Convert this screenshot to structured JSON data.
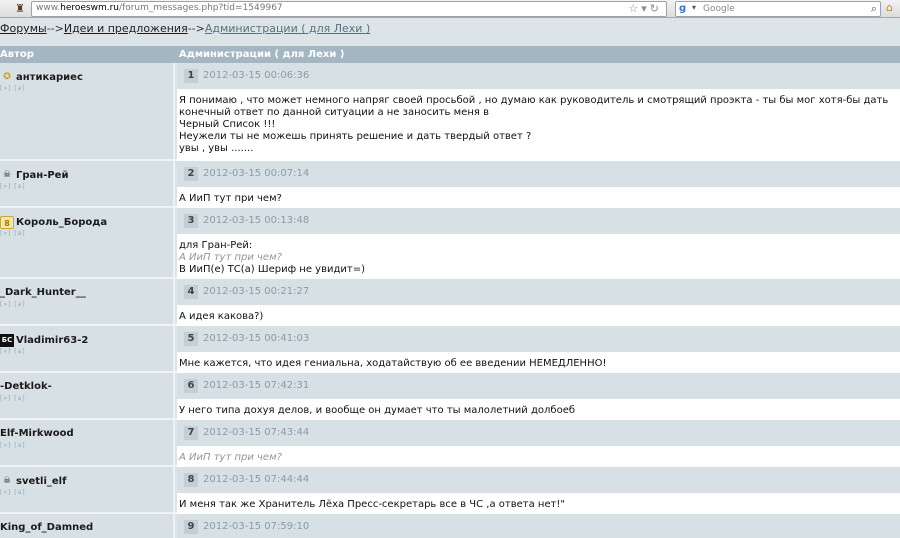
{
  "browser": {
    "url_prefix": "www.",
    "url_domain": "heroeswm.ru",
    "url_path": "/forum_messages.php?tid=1549967",
    "search_placeholder": "Google"
  },
  "breadcrumb": {
    "forums": "Форумы",
    "sep": "-->",
    "ideas": "Идеи и предложения",
    "topic": "Администрации ( для Лехи )"
  },
  "table": {
    "col_author": "Автор",
    "col_topic": "Администрации ( для Лехи )"
  },
  "author_links": "[»] [a]",
  "posts": [
    {
      "num": "1",
      "date": "2012-03-15 00:06:36",
      "author": "антикариес",
      "lines": [
        "Я понимаю , что может немного напряг своей просьбой , но думаю как руководитель и смотрящий проэкта - ты бы мог хотя-бы дать",
        "конечный ответ по данной ситуации а не заносить меня в",
        "Черный Список !!!",
        "Неужели ты не можешь принять решение и дать твердый ответ ?",
        "увы , увы ......."
      ]
    },
    {
      "num": "2",
      "date": "2012-03-15 00:07:14",
      "author": "Гран-Рей",
      "lines": [
        "А ИиП тут при чем?"
      ]
    },
    {
      "num": "3",
      "date": "2012-03-15 00:13:48",
      "author": "Король_Борода",
      "lines": [
        "для Гран-Рей:"
      ],
      "quote": "А ИиП тут при чем?",
      "after": "В ИиП(е) ТС(а) Шериф не увидит=)"
    },
    {
      "num": "4",
      "date": "2012-03-15 00:21:27",
      "author": "_Dark_Hunter__",
      "lines": [
        "А идея какова?)"
      ]
    },
    {
      "num": "5",
      "date": "2012-03-15 00:41:03",
      "author": "Vladimir63-2",
      "lines": [
        "Мне кажется, что идея гениальна, ходатайствую об ее введении НЕМЕДЛЕННО!"
      ]
    },
    {
      "num": "6",
      "date": "2012-03-15 07:42:31",
      "author": "-Detklok-",
      "lines": [
        "У него типа дохуя делов, и вообще он думает что ты малолетний долбоеб"
      ]
    },
    {
      "num": "7",
      "date": "2012-03-15 07:43:44",
      "author": "Elf-Mirkwood",
      "quote": "А ИиП тут при чем?"
    },
    {
      "num": "8",
      "date": "2012-03-15 07:44:44",
      "author": "svetli_elf",
      "lines": [
        "И меня так же Хранитель Лёха Пресс-секретарь все в ЧС ,а ответа нет!\""
      ]
    },
    {
      "num": "9",
      "date": "2012-03-15 07:59:10",
      "author": "King_of_Damned"
    }
  ],
  "badges": {
    "p1": "✪",
    "p2": "☠",
    "p3": "8",
    "p5": "БС",
    "p8": "☠"
  }
}
